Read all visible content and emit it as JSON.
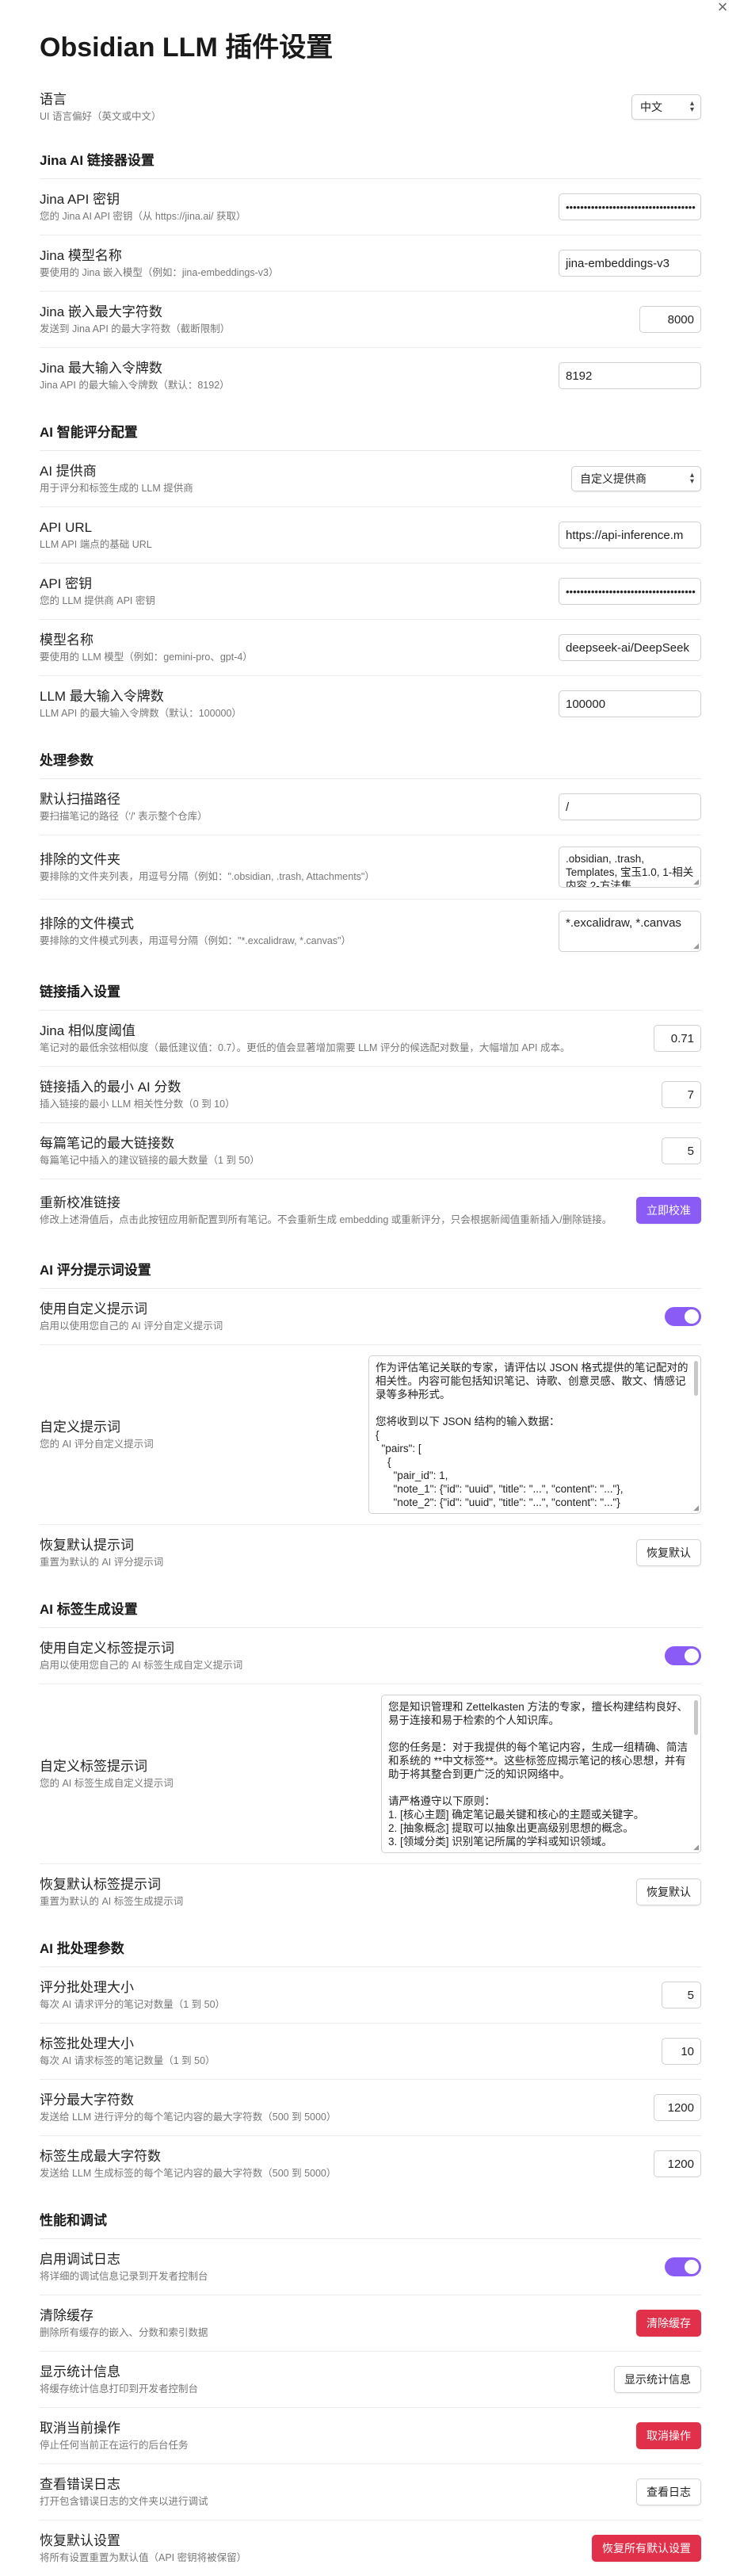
{
  "window": {
    "close_glyph": "×"
  },
  "page_title": "Obsidian LLM 插件设置",
  "language": {
    "name": "语言",
    "desc": "UI 语言偏好（英文或中文）",
    "value": "中文"
  },
  "sections": {
    "jina": "Jina AI 链接器设置",
    "ai": "AI 智能评分配置",
    "processing": "处理参数",
    "link_insert": "链接插入设置",
    "score_prompt": "AI 评分提示词设置",
    "tag_gen": "AI 标签生成设置",
    "batch": "AI 批处理参数",
    "perf": "性能和调试"
  },
  "jina": {
    "api_key": {
      "name": "Jina API 密钥",
      "desc": "您的 Jina AI API 密钥（从 https://jina.ai/ 获取）",
      "value": "••••••••••••••••••••••••••••••••••••"
    },
    "model": {
      "name": "Jina 模型名称",
      "desc": "要使用的 Jina 嵌入模型（例如：jina-embeddings-v3）",
      "value": "jina-embeddings-v3"
    },
    "max_chars": {
      "name": "Jina 嵌入最大字符数",
      "desc": "发送到 Jina API 的最大字符数（截断限制）",
      "value": "8000"
    },
    "max_tokens": {
      "name": "Jina 最大输入令牌数",
      "desc": "Jina API 的最大输入令牌数（默认：8192）",
      "value": "8192"
    }
  },
  "ai": {
    "provider": {
      "name": "AI 提供商",
      "desc": "用于评分和标签生成的 LLM 提供商",
      "value": "自定义提供商"
    },
    "api_url": {
      "name": "API URL",
      "desc": "LLM API 端点的基础 URL",
      "value": "https://api-inference.m"
    },
    "api_key": {
      "name": "API 密钥",
      "desc": "您的 LLM 提供商 API 密钥",
      "value": "••••••••••••••••••••••••••••••••••••"
    },
    "model": {
      "name": "模型名称",
      "desc": "要使用的 LLM 模型（例如：gemini-pro、gpt-4）",
      "value": "deepseek-ai/DeepSeek"
    },
    "max_tokens": {
      "name": "LLM 最大输入令牌数",
      "desc": "LLM API 的最大输入令牌数（默认：100000）",
      "value": "100000"
    }
  },
  "processing": {
    "scan_path": {
      "name": "默认扫描路径",
      "desc": "要扫描笔记的路径（'/' 表示整个仓库）",
      "value": "/"
    },
    "excluded_folders": {
      "name": "排除的文件夹",
      "desc": "要排除的文件夹列表，用逗号分隔（例如：\".obsidian, .trash, Attachments\"）",
      "value": ".obsidian, .trash, Templates, 宝玉1.0, 1-相关内容 2-方法集..."
    },
    "excluded_patterns": {
      "name": "排除的文件模式",
      "desc": "要排除的文件模式列表，用逗号分隔（例如：\"*.excalidraw, *.canvas\"）",
      "value": "*.excalidraw, *.canvas"
    }
  },
  "link_insert": {
    "threshold": {
      "name": "Jina 相似度阈值",
      "desc": "笔记对的最低余弦相似度（最低建议值：0.7）。更低的值会显著增加需要 LLM 评分的候选配对数量，大幅增加 API 成本。",
      "value": "0.71"
    },
    "min_score": {
      "name": "链接插入的最小 AI 分数",
      "desc": "插入链接的最小 LLM 相关性分数（0 到 10）",
      "value": "7"
    },
    "max_links": {
      "name": "每篇笔记的最大链接数",
      "desc": "每篇笔记中插入的建议链接的最大数量（1 到 50）",
      "value": "5"
    },
    "recalibrate": {
      "name": "重新校准链接",
      "desc": "修改上述滑值后，点击此按钮应用新配置到所有笔记。不会重新生成 embedding 或重新评分，只会根据新阈值重新插入/删除链接。",
      "button": "立即校准"
    }
  },
  "score_prompt": {
    "use_custom": {
      "name": "使用自定义提示词",
      "desc": "启用以使用您自己的 AI 评分自定义提示词"
    },
    "custom": {
      "name": "自定义提示词",
      "desc": "您的 AI 评分自定义提示词",
      "value": "作为评估笔记关联的专家，请评估以 JSON 格式提供的笔记配对的相关性。内容可能包括知识笔记、诗歌、创意灵感、散文、情感记录等多种形式。\n\n您将收到以下 JSON 结构的输入数据：\n{\n  \"pairs\": [\n    {\n      \"pair_id\": 1,\n      \"note_1\": {\"id\": \"uuid\", \"title\": \"...\", \"content\": \"...\"},\n      \"note_2\": {\"id\": \"uuid\", \"title\": \"...\", \"content\": \"...\"}"
    },
    "restore": {
      "name": "恢复默认提示词",
      "desc": "重置为默认的 AI 评分提示词",
      "button": "恢复默认"
    }
  },
  "tag_gen": {
    "use_custom": {
      "name": "使用自定义标签提示词",
      "desc": "启用以使用您自己的 AI 标签生成自定义提示词"
    },
    "custom": {
      "name": "自定义标签提示词",
      "desc": "您的 AI 标签生成自定义提示词",
      "value": "您是知识管理和 Zettelkasten 方法的专家，擅长构建结构良好、易于连接和易于检索的个人知识库。\n\n您的任务是：对于我提供的每个笔记内容，生成一组精确、简洁和系统的 **中文标签**。这些标签应揭示笔记的核心思想，并有助于将其整合到更广泛的知识网络中。\n\n请严格遵守以下原则：\n1. [核心主题] 确定笔记最关键和核心的主题或关键字。\n2. [抽象概念] 提取可以抽象出更高级别思想的概念。\n3. [领域分类] 识别笔记所属的学科或知识领域。"
    },
    "restore": {
      "name": "恢复默认标签提示词",
      "desc": "重置为默认的 AI 标签生成提示词",
      "button": "恢复默认"
    }
  },
  "batch": {
    "score_batch": {
      "name": "评分批处理大小",
      "desc": "每次 AI 请求评分的笔记对数量（1 到 50）",
      "value": "5"
    },
    "tag_batch": {
      "name": "标签批处理大小",
      "desc": "每次 AI 请求标签的笔记数量（1 到 50）",
      "value": "10"
    },
    "score_chars": {
      "name": "评分最大字符数",
      "desc": "发送给 LLM 进行评分的每个笔记内容的最大字符数（500 到 5000）",
      "value": "1200"
    },
    "tag_chars": {
      "name": "标签生成最大字符数",
      "desc": "发送给 LLM 生成标签的每个笔记内容的最大字符数（500 到 5000）",
      "value": "1200"
    }
  },
  "perf": {
    "debug": {
      "name": "启用调试日志",
      "desc": "将详细的调试信息记录到开发者控制台"
    },
    "clear_cache": {
      "name": "清除缓存",
      "desc": "删除所有缓存的嵌入、分数和索引数据",
      "button": "清除缓存"
    },
    "stats": {
      "name": "显示统计信息",
      "desc": "将缓存统计信息打印到开发者控制台",
      "button": "显示统计信息"
    },
    "cancel": {
      "name": "取消当前操作",
      "desc": "停止任何当前正在运行的后台任务",
      "button": "取消操作"
    },
    "error_log": {
      "name": "查看错误日志",
      "desc": "打开包含错误日志的文件夹以进行调试",
      "button": "查看日志"
    },
    "restore_all": {
      "name": "恢复默认设置",
      "desc": "将所有设置重置为默认值（API 密钥将被保留）",
      "button": "恢复所有默认设置"
    }
  },
  "colors": {
    "accent": "#8a5cf5",
    "danger": "#e0304a"
  },
  "icons": {
    "close": "close-icon",
    "chevron": "chevron-updown-icon",
    "toggle": "toggle-on"
  }
}
